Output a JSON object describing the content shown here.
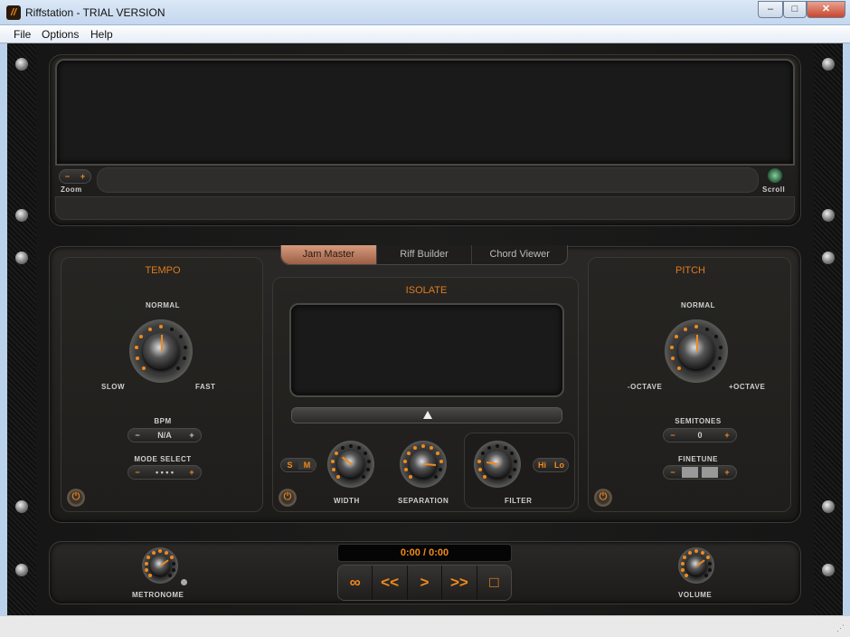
{
  "window": {
    "title": "Riffstation - TRIAL VERSION",
    "icon_text": "//",
    "minimize": "‒",
    "maximize": "□",
    "close": "✕"
  },
  "menu": [
    "File",
    "Options",
    "Help"
  ],
  "waveform": {
    "zoom_label": "Zoom",
    "zoom_out": "−",
    "zoom_in": "+",
    "scroll_label": "Scroll"
  },
  "tabs": [
    {
      "label": "Jam Master",
      "active": true
    },
    {
      "label": "Riff Builder",
      "active": false
    },
    {
      "label": "Chord Viewer",
      "active": false
    }
  ],
  "tempo": {
    "title": "TEMPO",
    "top": "NORMAL",
    "left": "SLOW",
    "right": "FAST",
    "bpm_label": "BPM",
    "bpm_value": "N/A",
    "minus": "−",
    "plus": "+",
    "mode_label": "MODE SELECT",
    "mode_value": "• • • •",
    "knob_level": 0.5
  },
  "isolate": {
    "title": "ISOLATE",
    "s": "S",
    "m": "M",
    "hi": "Hi",
    "lo": "Lo",
    "width_label": "WIDTH",
    "separation_label": "SEPARATION",
    "filter_label": "FILTER",
    "width_level": 0.3,
    "separation_level": 0.85,
    "filter_level": 0.2,
    "slider_position": 0.5
  },
  "pitch": {
    "title": "PITCH",
    "top": "NORMAL",
    "left": "-OCTAVE",
    "right": "+OCTAVE",
    "semitones_label": "SEMITONES",
    "semitones_value": "0",
    "finetune_label": "FINETUNE",
    "minus": "−",
    "plus": "+",
    "knob_level": 0.5
  },
  "bottom": {
    "metronome_label": "METRONOME",
    "volume_label": "VOLUME",
    "time": "0:00 / 0:00",
    "loop": "∞",
    "rewind": "<<",
    "play": ">",
    "forward": ">>",
    "stop": "□",
    "metronome_level": 0.7,
    "volume_level": 0.7
  },
  "power_icon": "⏻",
  "colors": {
    "accent": "#f08a1c",
    "background": "#1c1b1a"
  }
}
